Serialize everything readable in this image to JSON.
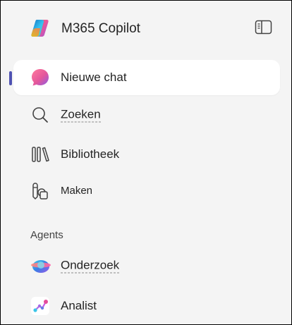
{
  "app": {
    "title": "M365 Copilot",
    "logo_icon": "copilot-logo-icon",
    "sidebar_toggle_icon": "sidebar-toggle-icon"
  },
  "nav": {
    "items": [
      {
        "label": "Nieuwe chat",
        "icon": "new-chat-icon",
        "active": true
      },
      {
        "label": "Zoeken",
        "icon": "search-icon",
        "active": false
      },
      {
        "label": "Bibliotheek",
        "icon": "library-icon",
        "active": false
      },
      {
        "label": "Maken",
        "icon": "create-icon",
        "active": false
      }
    ]
  },
  "agents": {
    "heading": "Agents",
    "items": [
      {
        "label": "Onderzoek",
        "icon": "researcher-agent-icon"
      },
      {
        "label": "Analist",
        "icon": "analyst-agent-icon"
      }
    ]
  },
  "colors": {
    "background": "#f4f4f4",
    "active_item_background": "#ffffff",
    "active_indicator": "#4f52b2",
    "text": "#242424"
  }
}
